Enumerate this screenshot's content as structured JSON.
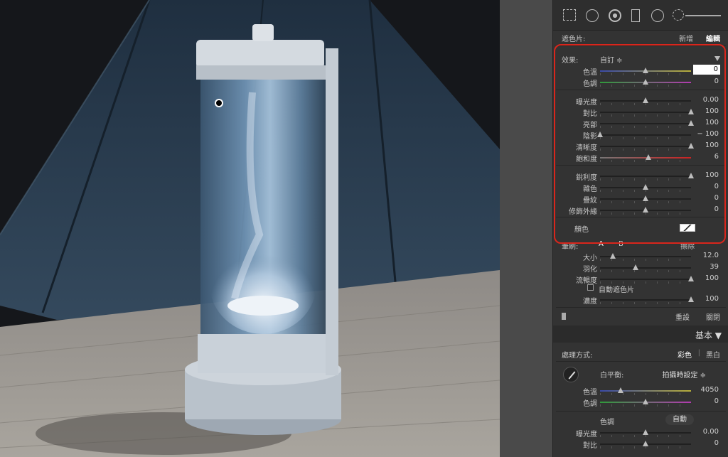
{
  "app": "Lightroom Develop Module",
  "mask_header": {
    "label": "遮色片:",
    "new_label": "新增",
    "edit_label": "編輯"
  },
  "effect": {
    "label": "效果:",
    "value": "自訂 ≑"
  },
  "sliders_group1": [
    {
      "label": "色溫",
      "value": "0",
      "level": 0.5,
      "track": "temp",
      "active": true
    },
    {
      "label": "色調",
      "value": "0",
      "level": 0.5,
      "track": "tint"
    }
  ],
  "sliders_group2": [
    {
      "label": "曝光度",
      "value": "0.00",
      "level": 0.5,
      "dim": true
    },
    {
      "label": "對比",
      "value": "100",
      "level": 1.0
    },
    {
      "label": "亮部",
      "value": "100",
      "level": 1.0
    },
    {
      "label": "陰影",
      "value": "− 100",
      "level": 0.0
    },
    {
      "label": "清晰度",
      "value": "100",
      "level": 1.0
    },
    {
      "label": "飽和度",
      "value": "6",
      "level": 0.53,
      "track": "sat"
    }
  ],
  "sliders_group3": [
    {
      "label": "銳利度",
      "value": "100",
      "level": 1.0
    },
    {
      "label": "雜色",
      "value": "0",
      "level": 0.5,
      "dim": true
    },
    {
      "label": "疊紋",
      "value": "0",
      "level": 0.5,
      "dim": true
    },
    {
      "label": "修飾外緣",
      "value": "0",
      "level": 0.5,
      "dim": true
    }
  ],
  "color": {
    "label": "顏色"
  },
  "brush": {
    "label": "筆刷:",
    "a": "A",
    "b": "B",
    "erase": "擦除"
  },
  "brush_sliders": [
    {
      "label": "大小",
      "value": "12.0",
      "level": 0.14
    },
    {
      "label": "羽化",
      "value": "39",
      "level": 0.39
    },
    {
      "label": "流暢度",
      "value": "100",
      "level": 1.0
    }
  ],
  "auto_mask": {
    "label": "自動遮色片"
  },
  "density": {
    "label": "濃度",
    "value": "100",
    "level": 1.0
  },
  "footer": {
    "reset": "重設",
    "close": "關閉"
  },
  "basic_panel": {
    "title": "基本 ▼",
    "treatment_label": "處理方式:",
    "color_option": "彩色",
    "bw_option": "黑白",
    "wb_label": "白平衡:",
    "wb_value": "拍攝時設定 ≑",
    "sliders": [
      {
        "label": "色溫",
        "value": "4050",
        "level": 0.23,
        "track": "temp"
      },
      {
        "label": "色調",
        "value": "0",
        "level": 0.5,
        "track": "tint"
      }
    ],
    "tone_label": "色調",
    "auto_label": "自動",
    "tone_sliders": [
      {
        "label": "曝光度",
        "value": "0.00",
        "level": 0.5
      },
      {
        "label": "對比",
        "value": "0",
        "level": 0.5
      }
    ]
  },
  "colors": {
    "accent_highlight": "#d9261c",
    "panel_bg": "#333333"
  }
}
